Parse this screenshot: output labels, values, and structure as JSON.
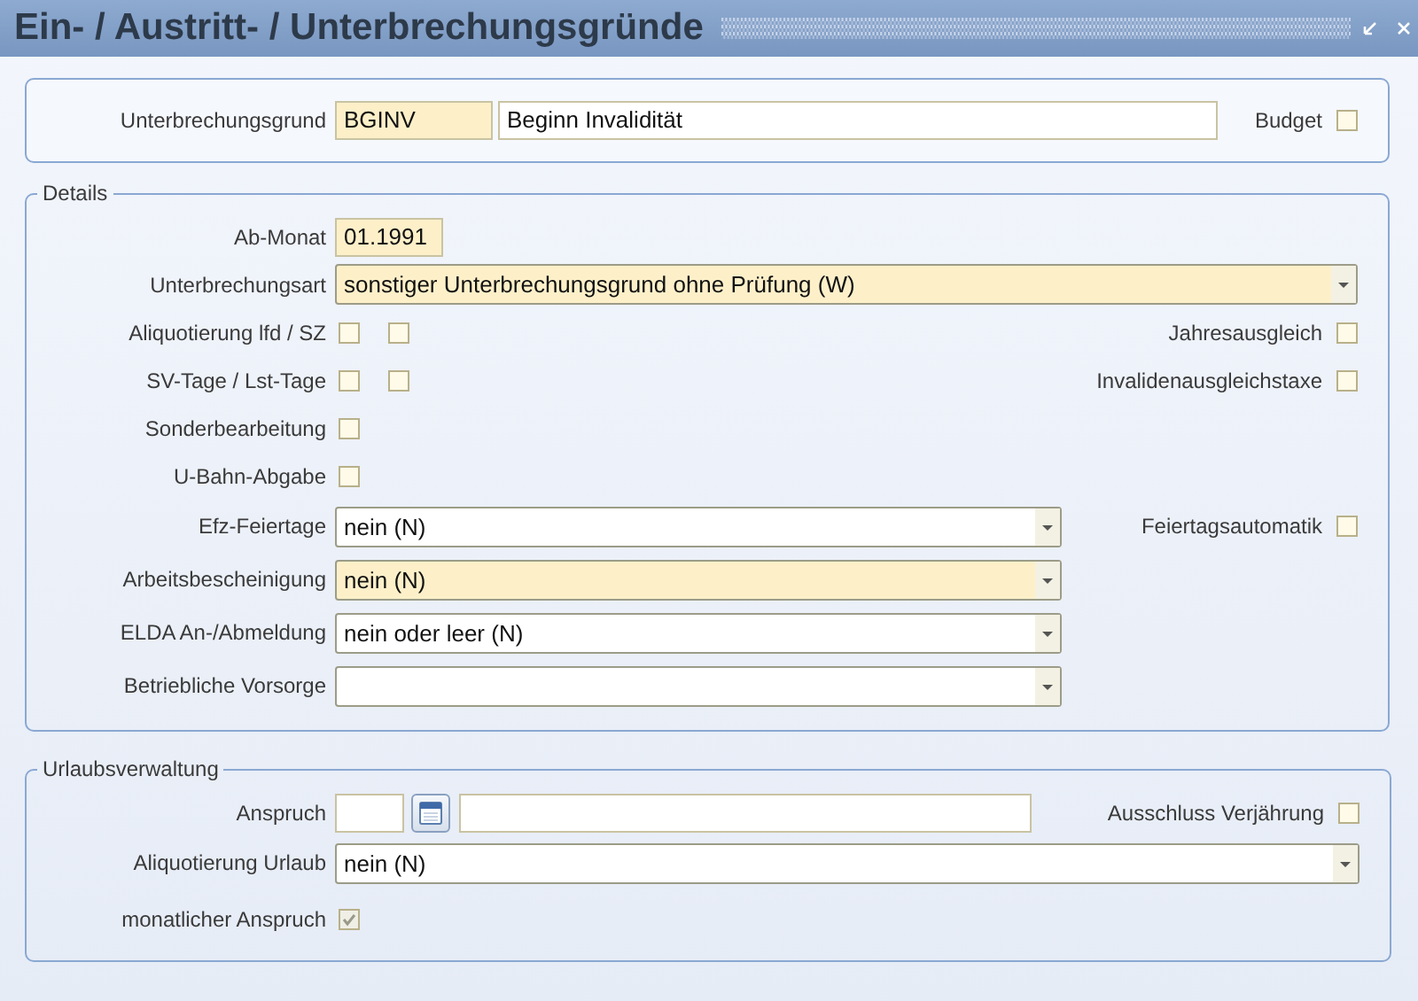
{
  "window": {
    "title": "Ein- / Austritt- / Unterbrechungsgründe"
  },
  "header_section": {
    "label": "Unterbrechungsgrund",
    "code": "BGINV",
    "description": "Beginn Invalidität",
    "budget": {
      "label": "Budget",
      "checked": false
    }
  },
  "details": {
    "legend": "Details",
    "rows": [
      {
        "kind": "input",
        "label": "Ab-Monat",
        "value": "01.1991",
        "highlighted": true
      },
      {
        "kind": "select",
        "label": "Unterbrechungsart",
        "value": "sonstiger Unterbrechungsgrund ohne Prüfung (W)",
        "highlighted": true
      },
      {
        "kind": "checkboxes",
        "label": "Aliquotierung lfd / SZ",
        "boxes": [
          {
            "checked": false
          },
          {
            "checked": false
          }
        ],
        "right": {
          "label": "Jahresausgleich",
          "checked": false
        }
      },
      {
        "kind": "checkboxes",
        "label": "SV-Tage / Lst-Tage",
        "boxes": [
          {
            "checked": false
          },
          {
            "checked": false
          }
        ],
        "right": {
          "label": "Invalidenausgleichstaxe",
          "checked": false
        }
      },
      {
        "kind": "checkboxes",
        "label": "Sonderbearbeitung",
        "boxes": [
          {
            "checked": false
          }
        ]
      },
      {
        "kind": "checkboxes",
        "label": "U-Bahn-Abgabe",
        "boxes": [
          {
            "checked": false
          }
        ]
      },
      {
        "kind": "select",
        "label": "Efz-Feiertage",
        "value": "nein (N)",
        "highlighted": false,
        "right": {
          "label": "Feiertagsautomatik",
          "checked": false
        }
      },
      {
        "kind": "select",
        "label": "Arbeitsbescheinigung",
        "value": "nein (N)",
        "highlighted": true
      },
      {
        "kind": "select",
        "label": "ELDA An-/Abmeldung",
        "value": "nein oder leer (N)",
        "highlighted": false
      },
      {
        "kind": "select",
        "label": "Betriebliche Vorsorge",
        "highlighted": false
      }
    ]
  },
  "vacation": {
    "legend": "Urlaubsverwaltung",
    "rows": [
      {
        "kind": "entitlement",
        "label": "Anspruch",
        "right": {
          "label": "Ausschluss Verjährung",
          "checked": false
        }
      },
      {
        "kind": "select",
        "label": "Aliquotierung Urlaub",
        "value": "nein (N)",
        "highlighted": false
      },
      {
        "kind": "checkboxes",
        "label": "monatlicher Anspruch",
        "boxes": [
          {
            "checked": true,
            "disabled": true
          }
        ]
      }
    ]
  }
}
